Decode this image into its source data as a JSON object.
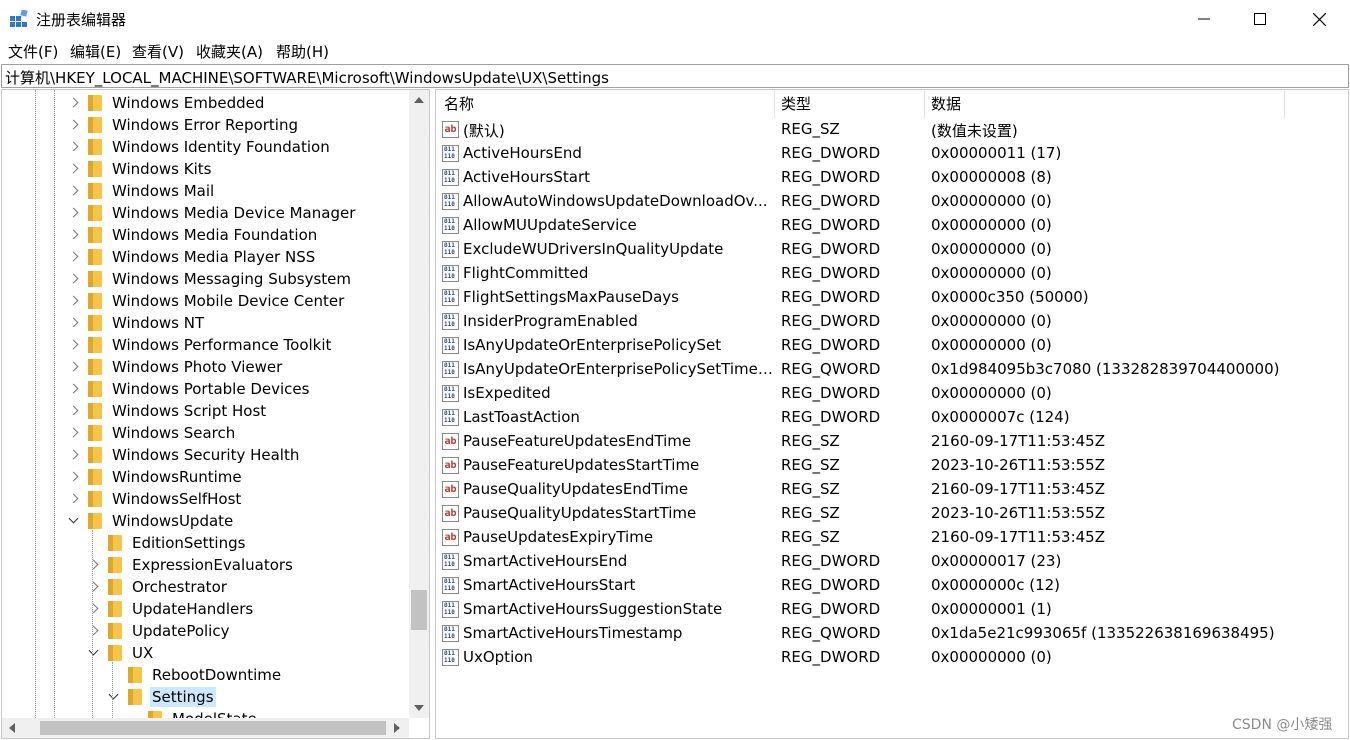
{
  "window": {
    "title": "注册表编辑器",
    "icons": {
      "app": "registry-editor-icon",
      "minimize": "minimize-icon",
      "maximize": "maximize-icon",
      "close": "close-icon"
    }
  },
  "menu": [
    "文件(F)",
    "编辑(E)",
    "查看(V)",
    "收藏夹(A)",
    "帮助(H)"
  ],
  "address": "计算机\\HKEY_LOCAL_MACHINE\\SOFTWARE\\Microsoft\\WindowsUpdate\\UX\\Settings",
  "tree": {
    "items": [
      {
        "label": "Windows Embedded",
        "expander": "collapsed",
        "depth": 0
      },
      {
        "label": "Windows Error Reporting",
        "expander": "collapsed",
        "depth": 0
      },
      {
        "label": "Windows Identity Foundation",
        "expander": "collapsed",
        "depth": 0
      },
      {
        "label": "Windows Kits",
        "expander": "collapsed",
        "depth": 0
      },
      {
        "label": "Windows Mail",
        "expander": "collapsed",
        "depth": 0
      },
      {
        "label": "Windows Media Device Manager",
        "expander": "collapsed",
        "depth": 0
      },
      {
        "label": "Windows Media Foundation",
        "expander": "collapsed",
        "depth": 0
      },
      {
        "label": "Windows Media Player NSS",
        "expander": "collapsed",
        "depth": 0
      },
      {
        "label": "Windows Messaging Subsystem",
        "expander": "collapsed",
        "depth": 0
      },
      {
        "label": "Windows Mobile Device Center",
        "expander": "collapsed",
        "depth": 0
      },
      {
        "label": "Windows NT",
        "expander": "collapsed",
        "depth": 0
      },
      {
        "label": "Windows Performance Toolkit",
        "expander": "collapsed",
        "depth": 0
      },
      {
        "label": "Windows Photo Viewer",
        "expander": "collapsed",
        "depth": 0
      },
      {
        "label": "Windows Portable Devices",
        "expander": "collapsed",
        "depth": 0
      },
      {
        "label": "Windows Script Host",
        "expander": "collapsed",
        "depth": 0
      },
      {
        "label": "Windows Search",
        "expander": "collapsed",
        "depth": 0
      },
      {
        "label": "Windows Security Health",
        "expander": "collapsed",
        "depth": 0
      },
      {
        "label": "WindowsRuntime",
        "expander": "collapsed",
        "depth": 0
      },
      {
        "label": "WindowsSelfHost",
        "expander": "collapsed",
        "depth": 0
      },
      {
        "label": "WindowsUpdate",
        "expander": "expanded",
        "depth": 0
      },
      {
        "label": "EditionSettings",
        "expander": "none",
        "depth": 1
      },
      {
        "label": "ExpressionEvaluators",
        "expander": "collapsed",
        "depth": 1
      },
      {
        "label": "Orchestrator",
        "expander": "collapsed",
        "depth": 1
      },
      {
        "label": "UpdateHandlers",
        "expander": "collapsed",
        "depth": 1
      },
      {
        "label": "UpdatePolicy",
        "expander": "collapsed",
        "depth": 1
      },
      {
        "label": "UX",
        "expander": "expanded",
        "depth": 1
      },
      {
        "label": "RebootDowntime",
        "expander": "none",
        "depth": 2
      },
      {
        "label": "Settings",
        "expander": "expanded",
        "depth": 2,
        "selected": true
      },
      {
        "label": "ModelState",
        "expander": "none",
        "depth": 3
      }
    ],
    "folder_icon": "folder-icon"
  },
  "list": {
    "columns": {
      "name": "名称",
      "type": "类型",
      "data": "数据"
    },
    "rows": [
      {
        "icon": "string-value-icon",
        "name": "(默认)",
        "type": "REG_SZ",
        "data": "(数值未设置)"
      },
      {
        "icon": "binary-value-icon",
        "name": "ActiveHoursEnd",
        "type": "REG_DWORD",
        "data": "0x00000011 (17)"
      },
      {
        "icon": "binary-value-icon",
        "name": "ActiveHoursStart",
        "type": "REG_DWORD",
        "data": "0x00000008 (8)"
      },
      {
        "icon": "binary-value-icon",
        "name": "AllowAutoWindowsUpdateDownloadOv...",
        "type": "REG_DWORD",
        "data": "0x00000000 (0)"
      },
      {
        "icon": "binary-value-icon",
        "name": "AllowMUUpdateService",
        "type": "REG_DWORD",
        "data": "0x00000000 (0)"
      },
      {
        "icon": "binary-value-icon",
        "name": "ExcludeWUDriversInQualityUpdate",
        "type": "REG_DWORD",
        "data": "0x00000000 (0)"
      },
      {
        "icon": "binary-value-icon",
        "name": "FlightCommitted",
        "type": "REG_DWORD",
        "data": "0x00000000 (0)"
      },
      {
        "icon": "binary-value-icon",
        "name": "FlightSettingsMaxPauseDays",
        "type": "REG_DWORD",
        "data": "0x0000c350 (50000)"
      },
      {
        "icon": "binary-value-icon",
        "name": "InsiderProgramEnabled",
        "type": "REG_DWORD",
        "data": "0x00000000 (0)"
      },
      {
        "icon": "binary-value-icon",
        "name": "IsAnyUpdateOrEnterprisePolicySet",
        "type": "REG_DWORD",
        "data": "0x00000000 (0)"
      },
      {
        "icon": "binary-value-icon",
        "name": "IsAnyUpdateOrEnterprisePolicySetTimeS...",
        "type": "REG_QWORD",
        "data": "0x1d984095b3c7080 (133282839704400000)"
      },
      {
        "icon": "binary-value-icon",
        "name": "IsExpedited",
        "type": "REG_DWORD",
        "data": "0x00000000 (0)"
      },
      {
        "icon": "binary-value-icon",
        "name": "LastToastAction",
        "type": "REG_DWORD",
        "data": "0x0000007c (124)"
      },
      {
        "icon": "string-value-icon",
        "name": "PauseFeatureUpdatesEndTime",
        "type": "REG_SZ",
        "data": "2160-09-17T11:53:45Z"
      },
      {
        "icon": "string-value-icon",
        "name": "PauseFeatureUpdatesStartTime",
        "type": "REG_SZ",
        "data": "2023-10-26T11:53:55Z"
      },
      {
        "icon": "string-value-icon",
        "name": "PauseQualityUpdatesEndTime",
        "type": "REG_SZ",
        "data": "2160-09-17T11:53:45Z"
      },
      {
        "icon": "string-value-icon",
        "name": "PauseQualityUpdatesStartTime",
        "type": "REG_SZ",
        "data": "2023-10-26T11:53:55Z"
      },
      {
        "icon": "string-value-icon",
        "name": "PauseUpdatesExpiryTime",
        "type": "REG_SZ",
        "data": "2160-09-17T11:53:45Z"
      },
      {
        "icon": "binary-value-icon",
        "name": "SmartActiveHoursEnd",
        "type": "REG_DWORD",
        "data": "0x00000017 (23)"
      },
      {
        "icon": "binary-value-icon",
        "name": "SmartActiveHoursStart",
        "type": "REG_DWORD",
        "data": "0x0000000c (12)"
      },
      {
        "icon": "binary-value-icon",
        "name": "SmartActiveHoursSuggestionState",
        "type": "REG_DWORD",
        "data": "0x00000001 (1)"
      },
      {
        "icon": "binary-value-icon",
        "name": "SmartActiveHoursTimestamp",
        "type": "REG_QWORD",
        "data": "0x1da5e21c993065f (133522638169638495)"
      },
      {
        "icon": "binary-value-icon",
        "name": "UxOption",
        "type": "REG_DWORD",
        "data": "0x00000000 (0)"
      }
    ],
    "icon_text": {
      "string": "ab",
      "binary": "011\n110"
    }
  },
  "watermark": "CSDN @小矮强",
  "colors": {
    "selection": "#cce8ff",
    "folder": "#f5c54a",
    "scrollbar_thumb": "#c2c2c2"
  }
}
